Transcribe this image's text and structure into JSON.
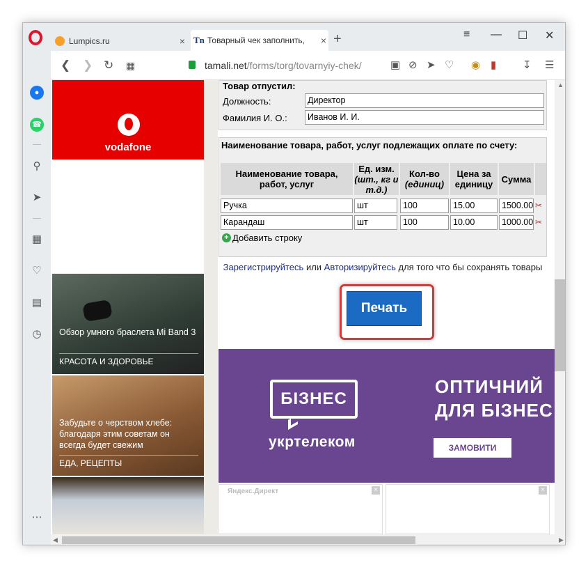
{
  "browser": {
    "tabs": [
      {
        "title": "Lumpics.ru",
        "close": "×"
      },
      {
        "title": "Товарный чек заполнить,",
        "close": "×"
      }
    ],
    "new_tab": "+",
    "url_domain": "tamali.net",
    "url_path": "/forms/torg/tovarnyiy-chek/"
  },
  "sidebar_ads": {
    "vodafone": "vodafone",
    "cards": [
      {
        "title": "Обзор умного браслета Mi Band 3",
        "category": "КРАСОТА И ЗДОРОВЬЕ"
      },
      {
        "title": "Забудьте о черством хлебе: благодаря этим советам он всегда будет свежим",
        "category": "ЕДА, РЕЦЕПТЫ"
      }
    ]
  },
  "form": {
    "released_title": "Товар отпустил:",
    "position_label": "Должность:",
    "position_value": "Директор",
    "name_label": "Фамилия И. О.:",
    "name_value": "Иванов И. И.",
    "goods_title": "Наименование товара, работ, услуг подлежащих оплате по счету:",
    "columns": {
      "name": "Наименование товара, работ, услуг",
      "unit_main": "Ед. изм.",
      "unit_sub": "(шт., кг и т.д.)",
      "qty_main": "Кол-во",
      "qty_sub": "(единиц)",
      "price": "Цена за единицу",
      "sum": "Сумма"
    },
    "rows": [
      {
        "name": "Ручка",
        "unit": "шт",
        "qty": "100",
        "price": "15.00",
        "sum": "1500.00"
      },
      {
        "name": "Карандаш",
        "unit": "шт",
        "qty": "100",
        "price": "10.00",
        "sum": "1000.00"
      }
    ],
    "add_row": "Добавить строку",
    "register_link": "Зарегистрируйтесь",
    "or": "или",
    "login_link": "Авторизируйтесь",
    "register_tail": "для того что бы сохранять товары",
    "print_button": "Печать"
  },
  "ad": {
    "bubble": "БІЗНЕС",
    "brand": "укртелеком",
    "headline_1": "ОПТИЧНИЙ",
    "headline_2": "ДЛЯ БІЗНЕС",
    "button": "ЗАМОВИТИ",
    "yandex_label": "Яндекс.Директ",
    "close": "×"
  }
}
